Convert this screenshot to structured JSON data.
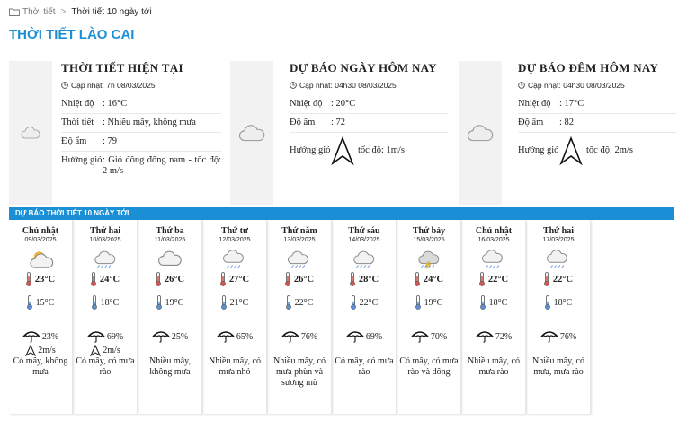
{
  "breadcrumb": {
    "home": "Thời tiết",
    "sep": ">",
    "current": "Thời tiết 10 ngày tới"
  },
  "title": "THỜI TIẾT LÀO CAI",
  "current": {
    "heading": "THỜI TIẾT HIỆN TẠI",
    "updated": "Cập nhật: 7h 08/03/2025",
    "rows": [
      {
        "k": "Nhiệt độ",
        "v": ": 16°C"
      },
      {
        "k": "Thời tiết",
        "v": ": Nhiều mây, không mưa"
      },
      {
        "k": "Độ ẩm",
        "v": ": 79"
      },
      {
        "k": "Hướng gió",
        "v": ": Gió đông đông nam - tốc độ: 2 m/s"
      }
    ]
  },
  "today": {
    "heading": "DỰ BÁO NGÀY HÔM NAY",
    "updated": "Cập nhật: 04h30 08/03/2025",
    "rows": [
      {
        "k": "Nhiệt độ",
        "v": ": 20°C"
      },
      {
        "k": "Độ ẩm",
        "v": ": 72"
      },
      {
        "k": "Hướng gió",
        "v": "tốc độ: 1m/s"
      }
    ]
  },
  "tonight": {
    "heading": "DỰ BÁO ĐÊM HÔM NAY",
    "updated": "Cập nhật: 04h30 08/03/2025",
    "rows": [
      {
        "k": "Nhiệt độ",
        "v": ": 17°C"
      },
      {
        "k": "Độ ẩm",
        "v": ": 82"
      },
      {
        "k": "Hướng gió",
        "v": "tốc độ: 2m/s"
      }
    ]
  },
  "forecast": {
    "heading": "DỰ BÁO THỜI TIẾT 10 NGÀY TỚI",
    "days": [
      {
        "name": "Chủ nhật",
        "date": "09/03/2025",
        "icon": "sun-cloud-icon",
        "high": "23°C",
        "low": "15°C",
        "rain": "23%",
        "wind": "2m/s",
        "desc": "Có mây, không mưa"
      },
      {
        "name": "Thứ hai",
        "date": "10/03/2025",
        "icon": "sun-cloud-rain-icon",
        "high": "24°C",
        "low": "18°C",
        "rain": "69%",
        "wind": "2m/s",
        "desc": "Có mây, có mưa rào"
      },
      {
        "name": "Thứ ba",
        "date": "11/03/2025",
        "icon": "cloud-icon",
        "high": "26°C",
        "low": "19°C",
        "rain": "25%",
        "wind": "",
        "desc": "Nhiều mây, không mưa"
      },
      {
        "name": "Thứ tư",
        "date": "12/03/2025",
        "icon": "cloud-rain-icon",
        "high": "27°C",
        "low": "21°C",
        "rain": "65%",
        "wind": "",
        "desc": "Nhiều mây, có mưa nhỏ"
      },
      {
        "name": "Thứ năm",
        "date": "13/03/2025",
        "icon": "cloud-drizzle-icon",
        "high": "26°C",
        "low": "22°C",
        "rain": "76%",
        "wind": "",
        "desc": "Nhiều mây, có mưa phùn và sương mù"
      },
      {
        "name": "Thứ sáu",
        "date": "14/03/2025",
        "icon": "sun-cloud-rain-icon",
        "high": "28°C",
        "low": "22°C",
        "rain": "69%",
        "wind": "",
        "desc": "Có mây, có mưa rào"
      },
      {
        "name": "Thứ bảy",
        "date": "15/03/2025",
        "icon": "thunderstorm-icon",
        "high": "24°C",
        "low": "19°C",
        "rain": "70%",
        "wind": "",
        "desc": "Có mây, có mưa rào và dông"
      },
      {
        "name": "Chủ nhật",
        "date": "16/03/2025",
        "icon": "cloud-rain-icon",
        "high": "22°C",
        "low": "18°C",
        "rain": "72%",
        "wind": "",
        "desc": "Nhiều mây, có mưa rào"
      },
      {
        "name": "Thứ hai",
        "date": "17/03/2025",
        "icon": "cloud-rain-icon",
        "high": "22°C",
        "low": "18°C",
        "rain": "76%",
        "wind": "",
        "desc": "Nhiều mây, có mưa, mưa rào"
      }
    ]
  },
  "colors": {
    "accent": "#1a8fd6",
    "thermo_high": "#d9534f",
    "thermo_low": "#5b8fd6"
  }
}
